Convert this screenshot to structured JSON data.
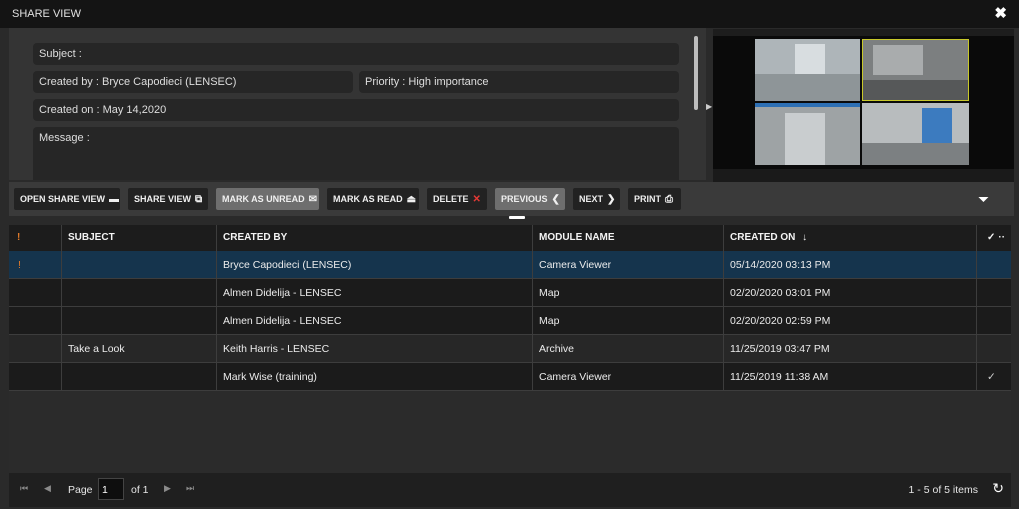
{
  "window": {
    "title": "SHARE VIEW"
  },
  "details": {
    "subject_label": "Subject  :",
    "created_by": "Created by  : Bryce Capodieci (LENSEC)",
    "priority": "Priority  : High importance",
    "created_on": "Created on  : May 14,2020",
    "message_label": "Message :"
  },
  "toolbar": {
    "open_share_view": "OPEN SHARE VIEW",
    "share_view": "SHARE VIEW",
    "mark_unread": "MARK AS UNREAD",
    "mark_read": "MARK AS READ",
    "delete": "DELETE",
    "previous": "PREVIOUS",
    "next": "NEXT",
    "print": "PRINT"
  },
  "grid": {
    "headers": {
      "priority": "!",
      "subject": "SUBJECT",
      "created_by": "CREATED BY",
      "module": "MODULE NAME",
      "created_on": "CREATED ON",
      "check": "✓"
    },
    "rows": [
      {
        "priority": "!",
        "subject": "",
        "created_by": "Bryce Capodieci (LENSEC)",
        "module": "Camera Viewer",
        "created_on": "05/14/2020 03:13 PM",
        "check": ""
      },
      {
        "priority": "",
        "subject": "",
        "created_by": "Almen Didelija - LENSEC",
        "module": "Map",
        "created_on": "02/20/2020 03:01 PM",
        "check": ""
      },
      {
        "priority": "",
        "subject": "",
        "created_by": "Almen Didelija - LENSEC",
        "module": "Map",
        "created_on": "02/20/2020 02:59 PM",
        "check": ""
      },
      {
        "priority": "",
        "subject": "Take a Look",
        "created_by": "Keith Harris - LENSEC",
        "module": "Archive",
        "created_on": "11/25/2019 03:47 PM",
        "check": ""
      },
      {
        "priority": "",
        "subject": "",
        "created_by": "Mark Wise (training)",
        "module": "Camera Viewer",
        "created_on": "11/25/2019 11:38 AM",
        "check": "✓"
      }
    ]
  },
  "pager": {
    "page_label": "Page",
    "page_value": "1",
    "of_label": "of 1",
    "items": "1 - 5 of 5 items"
  },
  "colors": {
    "priority_flag": "#e07a2a",
    "delete_x": "#e53935",
    "selected_row": "#15344d"
  }
}
